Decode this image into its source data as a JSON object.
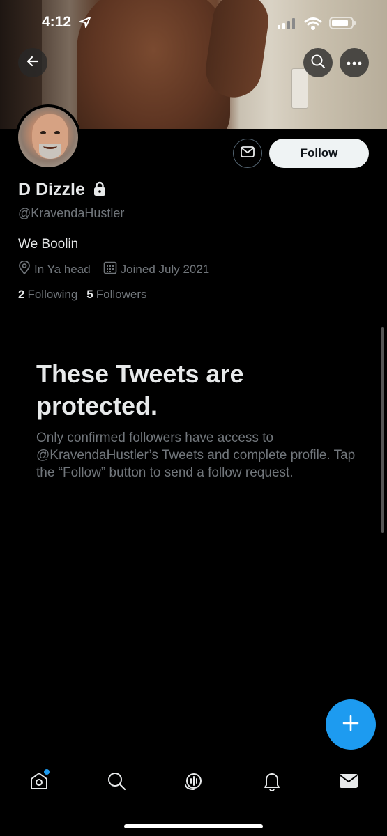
{
  "status_bar": {
    "time": "4:12"
  },
  "profile": {
    "display_name": "D Dizzle",
    "handle": "@KravendaHustler",
    "bio": "We Boolin",
    "location": "In Ya head",
    "joined": "Joined July 2021",
    "following_count": "2",
    "following_label": "Following",
    "followers_count": "5",
    "followers_label": "Followers"
  },
  "actions": {
    "follow_label": "Follow"
  },
  "protected": {
    "title": "These Tweets are protected.",
    "text": "Only confirmed followers have access to @KravendaHustler’s Tweets and complete profile. Tap the “Follow” button to send a follow request."
  },
  "icons": {
    "back": "arrow-left-icon",
    "search": "search-icon",
    "more": "more-icon",
    "message": "envelope-icon",
    "lock": "lock-icon",
    "location": "location-pin-icon",
    "calendar": "calendar-icon",
    "compose": "plus-icon",
    "nav": [
      "home-icon",
      "search-icon",
      "spaces-icon",
      "bell-icon",
      "mail-icon"
    ]
  },
  "colors": {
    "accent": "#1d9bf0",
    "background": "#000000",
    "primary_text": "#e7e9ea",
    "secondary_text": "#71767b"
  }
}
